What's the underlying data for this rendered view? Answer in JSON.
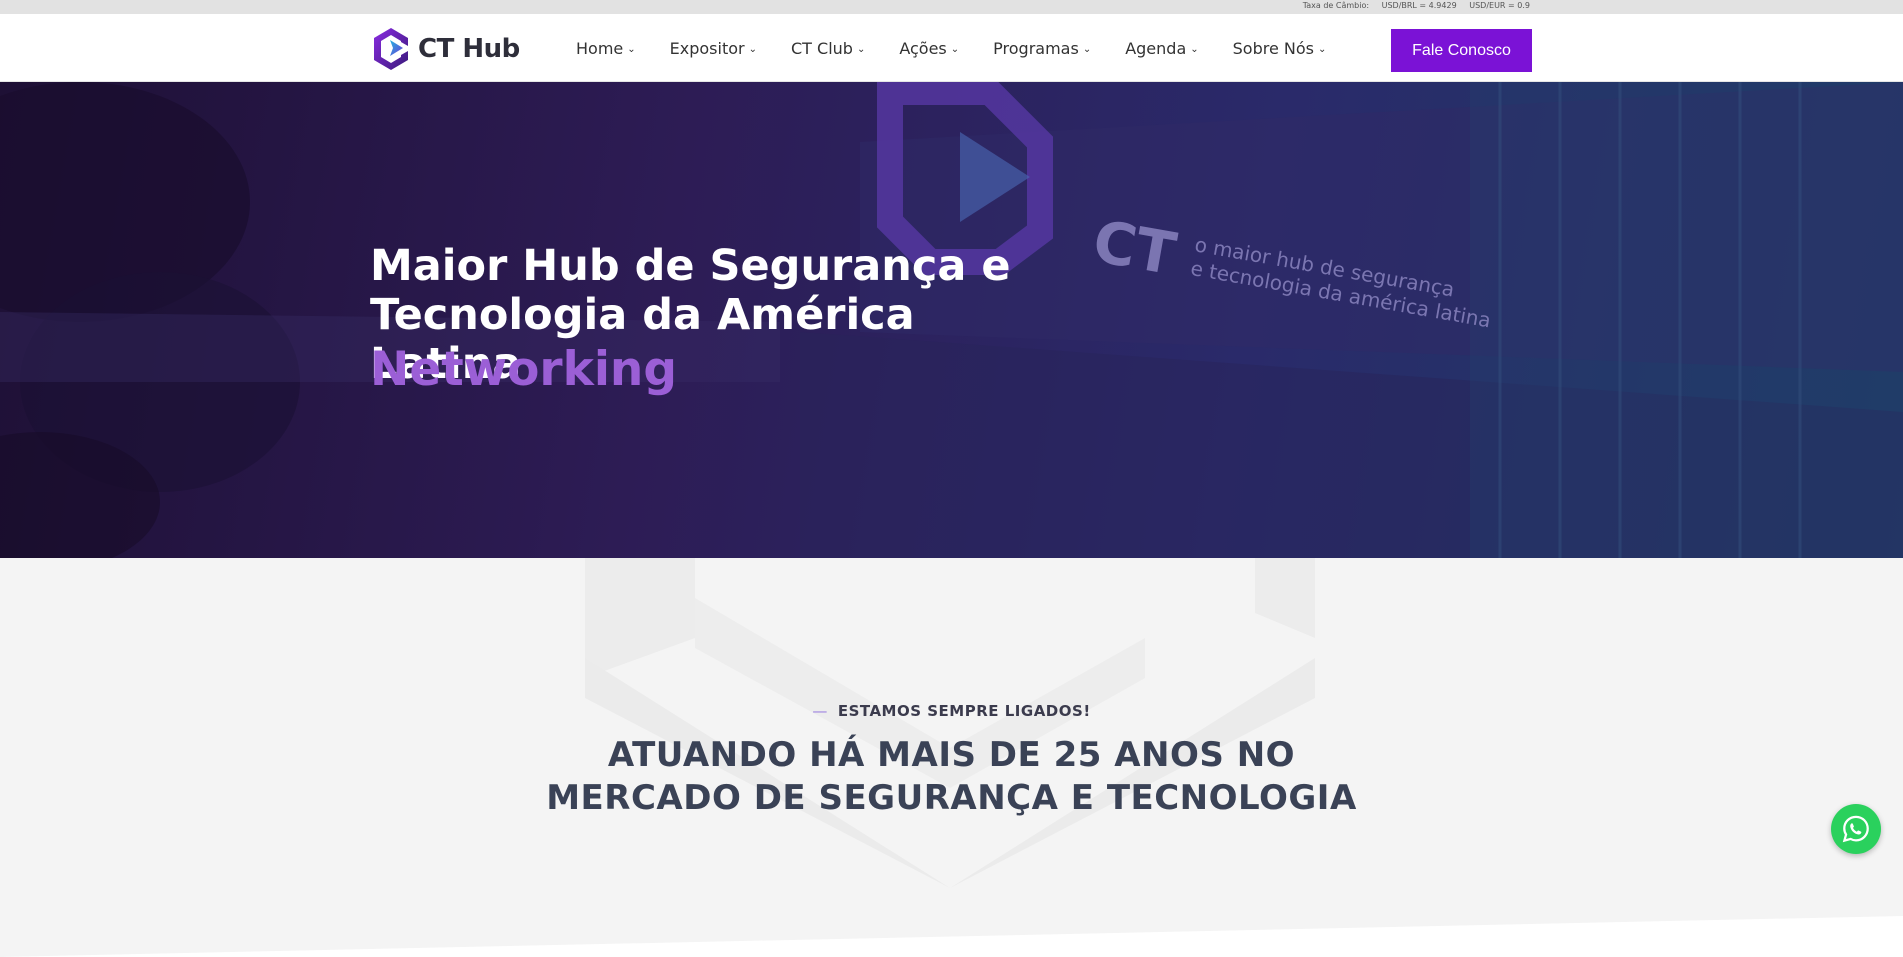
{
  "topbar": {
    "rate_label": "Taxa de Câmbio:",
    "usd_brl": "USD/BRL =  4.9429",
    "usd_eur": "USD/EUR =  0.9"
  },
  "brand": {
    "name": "CT Hub"
  },
  "nav": {
    "items": [
      {
        "label": "Home"
      },
      {
        "label": "Expositor"
      },
      {
        "label": "CT Club"
      },
      {
        "label": "Ações"
      },
      {
        "label": "Programas"
      },
      {
        "label": "Agenda"
      },
      {
        "label": "Sobre Nós"
      }
    ],
    "chevron_icon": "chevron-down-icon",
    "cta_label": "Fale Conosco"
  },
  "hero": {
    "line1": "Maior Hub de Segurança e",
    "line2_prefix": "Tecnologia da ",
    "line2_bold": "América Latina",
    "accent": "Networking",
    "sign_text_1": "CT",
    "sign_text_2": "o maior hub de segurança",
    "sign_text_3": "e tecnologia da américa latina"
  },
  "section": {
    "eyebrow": "ESTAMOS SEMPRE LIGADOS!",
    "headline_line1": "ATUANDO HÁ MAIS DE 25 ANOS NO",
    "headline_line2": "MERCADO DE SEGURANÇA E TECNOLOGIA"
  },
  "colors": {
    "brand_purple": "#7b12d6",
    "accent_purple": "#9b5fd6",
    "whatsapp_green": "#2ad15d"
  },
  "floating": {
    "icon": "whatsapp-icon"
  }
}
